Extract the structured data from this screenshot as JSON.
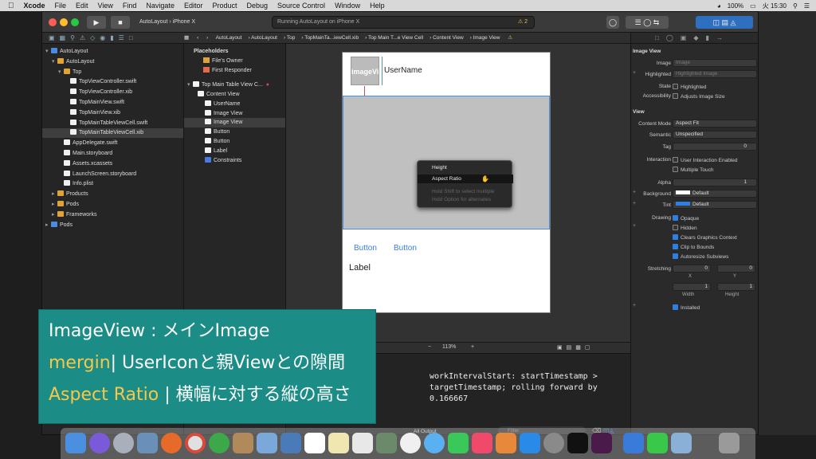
{
  "menubar": {
    "app": "Xcode",
    "items": [
      "File",
      "Edit",
      "View",
      "Find",
      "Navigate",
      "Editor",
      "Product",
      "Debug",
      "Source Control",
      "Window",
      "Help"
    ],
    "battery": "100%",
    "clock": "火 15:30"
  },
  "toolbar": {
    "scheme_target": "AutoLayout",
    "scheme_device": "iPhone X",
    "activity_text": "Running AutoLayout on iPhone X",
    "warning_count": "2"
  },
  "jumpbar": [
    "AutoLayout",
    "AutoLayout",
    "Top",
    "TopMainTa...iewCell.xib",
    "Top Main T...e View Cell",
    "Content View",
    "Image View"
  ],
  "navigator": [
    {
      "label": "AutoLayout",
      "kind": "project",
      "indent": 0
    },
    {
      "label": "AutoLayout",
      "kind": "folder",
      "indent": 1
    },
    {
      "label": "Top",
      "kind": "folder",
      "indent": 2
    },
    {
      "label": "TopViewController.swift",
      "kind": "file",
      "indent": 3
    },
    {
      "label": "TopViewController.xib",
      "kind": "file",
      "indent": 3
    },
    {
      "label": "TopMainView.swift",
      "kind": "file",
      "indent": 3
    },
    {
      "label": "TopMainView.xib",
      "kind": "file",
      "indent": 3
    },
    {
      "label": "TopMainTableViewCell.swift",
      "kind": "file",
      "indent": 3
    },
    {
      "label": "TopMainTableViewCell.xib",
      "kind": "file",
      "indent": 3,
      "selected": true
    },
    {
      "label": "AppDelegate.swift",
      "kind": "file",
      "indent": 2
    },
    {
      "label": "Main.storyboard",
      "kind": "file",
      "indent": 2
    },
    {
      "label": "Assets.xcassets",
      "kind": "file",
      "indent": 2
    },
    {
      "label": "LaunchScreen.storyboard",
      "kind": "file",
      "indent": 2
    },
    {
      "label": "Info.plist",
      "kind": "file",
      "indent": 2
    },
    {
      "label": "Products",
      "kind": "folder",
      "indent": 1
    },
    {
      "label": "Pods",
      "kind": "folder",
      "indent": 1
    },
    {
      "label": "Frameworks",
      "kind": "folder",
      "indent": 1
    },
    {
      "label": "Pods",
      "kind": "project",
      "indent": 0
    }
  ],
  "outline": {
    "placeholders_header": "Placeholders",
    "placeholders": [
      "File's Owner",
      "First Responder"
    ],
    "root": "Top Main Table View C...",
    "items": [
      {
        "label": "Content View",
        "indent": 1
      },
      {
        "label": "UserName",
        "indent": 2
      },
      {
        "label": "Image View",
        "indent": 2
      },
      {
        "label": "Image View",
        "indent": 2,
        "selected": true
      },
      {
        "label": "Button",
        "indent": 2
      },
      {
        "label": "Button",
        "indent": 2
      },
      {
        "label": "Label",
        "indent": 2
      },
      {
        "label": "Constraints",
        "indent": 2
      }
    ]
  },
  "canvas": {
    "image_placeholder": "imageVi",
    "username": "UserName",
    "button1": "Button",
    "button2": "Button",
    "label": "Label",
    "zoom": "113%"
  },
  "popup_menu": {
    "items": [
      {
        "label": "Height"
      },
      {
        "label": "Aspect Ratio",
        "highlighted": true
      },
      {
        "label": "Hold Shift to select multiple",
        "dim": true
      },
      {
        "label": "Hold Option for alternates",
        "dim": true
      }
    ]
  },
  "console": {
    "text": "workIntervalStart: startTimestamp >\ntargetTimestamp; rolling forward by\n0.166667",
    "output_selector": "All Output",
    "filter_placeholder": "Filter"
  },
  "inspector": {
    "image_view_header": "Image View",
    "image_label": "Image",
    "image_placeholder": "Image",
    "highlighted_label": "Highlighted",
    "highlighted_placeholder": "Highlighted Image",
    "state_label": "State",
    "state_option": "Highlighted",
    "accessibility_label": "Accessibility",
    "accessibility_option": "Adjusts Image Size",
    "view_header": "View",
    "content_mode_label": "Content Mode",
    "content_mode": "Aspect Fit",
    "semantic_label": "Semantic",
    "semantic": "Unspecified",
    "tag_label": "Tag",
    "tag": "0",
    "interaction_label": "Interaction",
    "interaction_opt1": "User Interaction Enabled",
    "interaction_opt2": "Multiple Touch",
    "alpha_label": "Alpha",
    "alpha": "1",
    "background_label": "Background",
    "background": "Default",
    "tint_label": "Tint",
    "tint": "Default",
    "drawing_label": "Drawing",
    "drawing_opts": [
      "Opaque",
      "Hidden",
      "Clears Graphics Context",
      "Clip to Bounds",
      "Autoresize Subviews"
    ],
    "stretching_label": "Stretching",
    "stretch_x": "0",
    "stretch_y": "0",
    "stretch_w": "1",
    "stretch_h": "1",
    "x_label": "X",
    "y_label": "Y",
    "width_label": "Width",
    "height_label": "Height",
    "installed": "Installed"
  },
  "caption": {
    "line1": "ImageView : メインImage",
    "line2_key": "mergin",
    "line2_rest": "| UserIconと親Viewとの隙間",
    "line3_key": "Aspect Ratio",
    "line3_rest": " | 横幅に対する縦の高さ"
  },
  "colors": {
    "caption_bg": "#1c8c86",
    "caption_accent": "#f6c84a",
    "selection_blue": "#2f7fe0"
  }
}
